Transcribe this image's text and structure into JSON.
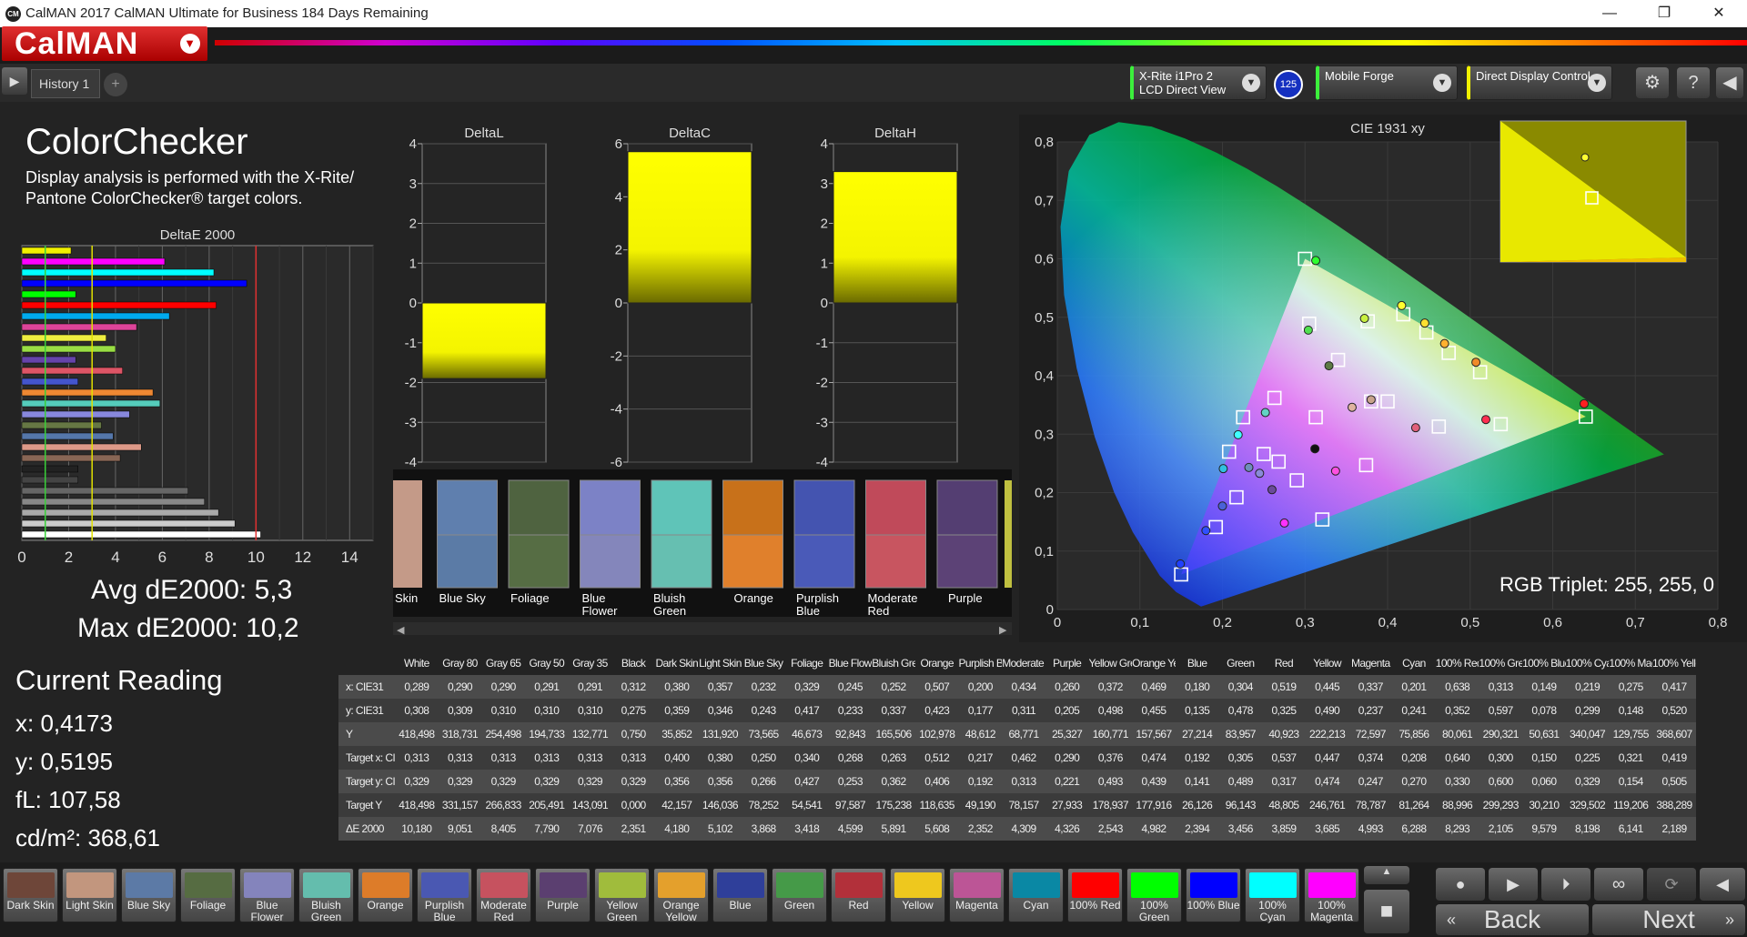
{
  "window": {
    "title": "CalMAN 2017 CalMAN Ultimate for Business 184 Days Remaining",
    "minimize": "—",
    "maximize": "❐",
    "close": "✕"
  },
  "logo": "CalMAN",
  "tabs": {
    "history": "History 1",
    "add": "+"
  },
  "devices": {
    "meter_line1": "X-Rite i1Pro 2",
    "meter_line2": "LCD Direct View",
    "meter_badge": "125",
    "source": "Mobile Forge",
    "display": "Direct Display Control"
  },
  "page": {
    "title": "ColorChecker",
    "desc_line1": "Display analysis is performed with the X-Rite/",
    "desc_line2": "Pantone ColorChecker® target colors."
  },
  "deltae_chart": {
    "title": "DeltaE 2000",
    "ticks": [
      "0",
      "2",
      "4",
      "6",
      "8",
      "10",
      "12",
      "14"
    ],
    "xlim": [
      0,
      15
    ],
    "bars": [
      {
        "v": 2.1,
        "c": "#f0f000"
      },
      {
        "v": 6.1,
        "c": "#ff00ff"
      },
      {
        "v": 8.2,
        "c": "#00ffff"
      },
      {
        "v": 9.6,
        "c": "#0000ff"
      },
      {
        "v": 2.3,
        "c": "#00ff00"
      },
      {
        "v": 8.3,
        "c": "#ff0000"
      },
      {
        "v": 6.3,
        "c": "#00aaee"
      },
      {
        "v": 4.9,
        "c": "#dd4499"
      },
      {
        "v": 3.6,
        "c": "#eeee40"
      },
      {
        "v": 4.0,
        "c": "#99dd44"
      },
      {
        "v": 2.3,
        "c": "#6644aa"
      },
      {
        "v": 4.3,
        "c": "#dd5566"
      },
      {
        "v": 2.4,
        "c": "#4455cc"
      },
      {
        "v": 5.6,
        "c": "#ee8833"
      },
      {
        "v": 5.9,
        "c": "#55ccbb"
      },
      {
        "v": 4.6,
        "c": "#8888dd"
      },
      {
        "v": 3.4,
        "c": "#667744"
      },
      {
        "v": 3.9,
        "c": "#5577aa"
      },
      {
        "v": 5.1,
        "c": "#dd9988"
      },
      {
        "v": 4.2,
        "c": "#886655"
      },
      {
        "v": 2.4,
        "c": "#222222"
      },
      {
        "v": 2.4,
        "c": "#444444"
      },
      {
        "v": 7.1,
        "c": "#666666"
      },
      {
        "v": 7.8,
        "c": "#888888"
      },
      {
        "v": 8.4,
        "c": "#aaaaaa"
      },
      {
        "v": 9.1,
        "c": "#cccccc"
      },
      {
        "v": 10.2,
        "c": "#ffffff"
      }
    ]
  },
  "delta_charts": [
    {
      "title": "DeltaL",
      "ticks": [
        "4",
        "3",
        "2",
        "1",
        "0",
        "-1",
        "-2",
        "-3",
        "-4"
      ],
      "ylim": [
        -4,
        4
      ],
      "value": -1.9
    },
    {
      "title": "DeltaC",
      "ticks": [
        "6",
        "4",
        "2",
        "0",
        "-2",
        "-4",
        "-6"
      ],
      "ylim": [
        -6,
        6
      ],
      "value": 5.7
    },
    {
      "title": "DeltaH",
      "ticks": [
        "4",
        "3",
        "2",
        "1",
        "0",
        "-1",
        "-2",
        "-3",
        "-4"
      ],
      "ylim": [
        -4,
        4
      ],
      "value": 3.3
    }
  ],
  "patches": [
    {
      "name": "Skin",
      "a": "#c49a88",
      "t": "#c79f8a"
    },
    {
      "name": "Blue Sky",
      "a": "#5f7fae",
      "t": "#5b7ba6"
    },
    {
      "name": "Foliage",
      "a": "#4f6340",
      "t": "#566d44"
    },
    {
      "name": "Blue Flower",
      "a": "#7c82c6",
      "t": "#8486bb"
    },
    {
      "name": "Bluish Green",
      "a": "#5fc4b8",
      "t": "#66bfb1"
    },
    {
      "name": "Orange",
      "a": "#c8711a",
      "t": "#e0802c"
    },
    {
      "name": "Purplish Blue",
      "a": "#4454b0",
      "t": "#4a5ab8"
    },
    {
      "name": "Moderate Red",
      "a": "#c04a5a",
      "t": "#c85560"
    },
    {
      "name": "Purple",
      "a": "#543e72",
      "t": "#5c4276"
    }
  ],
  "patch_labels": [
    "Skin",
    "Blue Sky",
    "Foliage",
    "Blue\nFlower",
    "Bluish\nGreen",
    "Orange",
    "Purplish\nBlue",
    "Moderate\nRed",
    "Purple"
  ],
  "summary": {
    "avg": "Avg dE2000: 5,3",
    "max": "Max dE2000: 10,2"
  },
  "current": {
    "title": "Current Reading",
    "x": "x: 0,4173",
    "y": "y: 0,5195",
    "fl": "fL: 107,58",
    "cdm": "cd/m²: 368,61"
  },
  "cie": {
    "title": "CIE 1931 xy",
    "xticks": [
      "0",
      "0,1",
      "0,2",
      "0,3",
      "0,4",
      "0,5",
      "0,6",
      "0,7",
      "0,8"
    ],
    "yticks": [
      "0,8",
      "0,7",
      "0,6",
      "0,5",
      "0,4",
      "0,3",
      "0,2",
      "0,1",
      "0"
    ],
    "triplet": "RGB Triplet: 255, 255, 0",
    "targets": [
      [
        0.313,
        0.329
      ],
      [
        0.4,
        0.356
      ],
      [
        0.38,
        0.356
      ],
      [
        0.25,
        0.266
      ],
      [
        0.34,
        0.427
      ],
      [
        0.268,
        0.253
      ],
      [
        0.263,
        0.362
      ],
      [
        0.512,
        0.406
      ],
      [
        0.217,
        0.192
      ],
      [
        0.462,
        0.313
      ],
      [
        0.29,
        0.221
      ],
      [
        0.376,
        0.493
      ],
      [
        0.474,
        0.439
      ],
      [
        0.192,
        0.141
      ],
      [
        0.305,
        0.489
      ],
      [
        0.537,
        0.317
      ],
      [
        0.447,
        0.474
      ],
      [
        0.374,
        0.247
      ],
      [
        0.208,
        0.27
      ],
      [
        0.64,
        0.33
      ],
      [
        0.3,
        0.6
      ],
      [
        0.15,
        0.06
      ],
      [
        0.225,
        0.329
      ],
      [
        0.321,
        0.154
      ],
      [
        0.419,
        0.505
      ]
    ],
    "measured": [
      {
        "x": 0.312,
        "y": 0.275,
        "c": "#111"
      },
      {
        "x": 0.38,
        "y": 0.359,
        "c": "#c9a38c"
      },
      {
        "x": 0.357,
        "y": 0.346,
        "c": "#dfb3a0"
      },
      {
        "x": 0.232,
        "y": 0.243,
        "c": "#6f8fbb"
      },
      {
        "x": 0.329,
        "y": 0.417,
        "c": "#5d7a44"
      },
      {
        "x": 0.245,
        "y": 0.233,
        "c": "#8a8ad8"
      },
      {
        "x": 0.252,
        "y": 0.337,
        "c": "#64d3c4"
      },
      {
        "x": 0.507,
        "y": 0.423,
        "c": "#f08a2a"
      },
      {
        "x": 0.2,
        "y": 0.177,
        "c": "#4a62d8"
      },
      {
        "x": 0.434,
        "y": 0.311,
        "c": "#e0607a"
      },
      {
        "x": 0.26,
        "y": 0.205,
        "c": "#6a4a9a"
      },
      {
        "x": 0.372,
        "y": 0.498,
        "c": "#c8f040"
      },
      {
        "x": 0.469,
        "y": 0.455,
        "c": "#ffb030"
      },
      {
        "x": 0.18,
        "y": 0.135,
        "c": "#3050ff"
      },
      {
        "x": 0.304,
        "y": 0.478,
        "c": "#50e050"
      },
      {
        "x": 0.519,
        "y": 0.325,
        "c": "#ff3050"
      },
      {
        "x": 0.445,
        "y": 0.49,
        "c": "#ffe030"
      },
      {
        "x": 0.337,
        "y": 0.237,
        "c": "#ff50e0"
      },
      {
        "x": 0.201,
        "y": 0.241,
        "c": "#30c0e0"
      },
      {
        "x": 0.638,
        "y": 0.352,
        "c": "#ff2020"
      },
      {
        "x": 0.313,
        "y": 0.597,
        "c": "#30ff30"
      },
      {
        "x": 0.149,
        "y": 0.078,
        "c": "#2040ff"
      },
      {
        "x": 0.219,
        "y": 0.299,
        "c": "#40ffff"
      },
      {
        "x": 0.275,
        "y": 0.148,
        "c": "#ff30ff"
      },
      {
        "x": 0.417,
        "y": 0.52,
        "c": "#ffff30"
      }
    ]
  },
  "table": {
    "headers": [
      "White",
      "Gray 80",
      "Gray 65",
      "Gray 50",
      "Gray 35",
      "Black",
      "Dark Skin",
      "Light Skin",
      "Blue Sky",
      "Foliage",
      "Blue Flower",
      "Bluish Green",
      "Orange",
      "Purplish Blue",
      "Moderate Red",
      "Purple",
      "Yellow Green",
      "Orange Yellow",
      "Blue",
      "Green",
      "Red",
      "Yellow",
      "Magenta",
      "Cyan",
      "100% Red",
      "100% Green",
      "100% Blue",
      "100% Cyan",
      "100% Magenta",
      "100% Yellow"
    ],
    "rows": [
      {
        "label": "x: CIE31",
        "vals": [
          "0,289",
          "0,290",
          "0,290",
          "0,291",
          "0,291",
          "0,312",
          "0,380",
          "0,357",
          "0,232",
          "0,329",
          "0,245",
          "0,252",
          "0,507",
          "0,200",
          "0,434",
          "0,260",
          "0,372",
          "0,469",
          "0,180",
          "0,304",
          "0,519",
          "0,445",
          "0,337",
          "0,201",
          "0,638",
          "0,313",
          "0,149",
          "0,219",
          "0,275",
          "0,417"
        ]
      },
      {
        "label": "y: CIE31",
        "vals": [
          "0,308",
          "0,309",
          "0,310",
          "0,310",
          "0,310",
          "0,275",
          "0,359",
          "0,346",
          "0,243",
          "0,417",
          "0,233",
          "0,337",
          "0,423",
          "0,177",
          "0,311",
          "0,205",
          "0,498",
          "0,455",
          "0,135",
          "0,478",
          "0,325",
          "0,490",
          "0,237",
          "0,241",
          "0,352",
          "0,597",
          "0,078",
          "0,299",
          "0,148",
          "0,520"
        ]
      },
      {
        "label": "Y",
        "vals": [
          "418,498",
          "318,731",
          "254,498",
          "194,733",
          "132,771",
          "0,750",
          "35,852",
          "131,920",
          "73,565",
          "46,673",
          "92,843",
          "165,506",
          "102,978",
          "48,612",
          "68,771",
          "25,327",
          "160,771",
          "157,567",
          "27,214",
          "83,957",
          "40,923",
          "222,213",
          "72,597",
          "75,856",
          "80,061",
          "290,321",
          "50,631",
          "340,047",
          "129,755",
          "368,607"
        ]
      },
      {
        "label": "Target x: CIE31",
        "vals": [
          "0,313",
          "0,313",
          "0,313",
          "0,313",
          "0,313",
          "0,313",
          "0,400",
          "0,380",
          "0,250",
          "0,340",
          "0,268",
          "0,263",
          "0,512",
          "0,217",
          "0,462",
          "0,290",
          "0,376",
          "0,474",
          "0,192",
          "0,305",
          "0,537",
          "0,447",
          "0,374",
          "0,208",
          "0,640",
          "0,300",
          "0,150",
          "0,225",
          "0,321",
          "0,419"
        ]
      },
      {
        "label": "Target y: CIE31",
        "vals": [
          "0,329",
          "0,329",
          "0,329",
          "0,329",
          "0,329",
          "0,329",
          "0,356",
          "0,356",
          "0,266",
          "0,427",
          "0,253",
          "0,362",
          "0,406",
          "0,192",
          "0,313",
          "0,221",
          "0,493",
          "0,439",
          "0,141",
          "0,489",
          "0,317",
          "0,474",
          "0,247",
          "0,270",
          "0,330",
          "0,600",
          "0,060",
          "0,329",
          "0,154",
          "0,505"
        ]
      },
      {
        "label": "Target Y",
        "vals": [
          "418,498",
          "331,157",
          "266,833",
          "205,491",
          "143,091",
          "0,000",
          "42,157",
          "146,036",
          "78,252",
          "54,541",
          "97,587",
          "175,238",
          "118,635",
          "49,190",
          "78,157",
          "27,933",
          "178,937",
          "177,916",
          "26,126",
          "96,143",
          "48,805",
          "246,761",
          "78,787",
          "81,264",
          "88,996",
          "299,293",
          "30,210",
          "329,502",
          "119,206",
          "388,289"
        ]
      },
      {
        "label": "ΔE 2000",
        "vals": [
          "10,180",
          "9,051",
          "8,405",
          "7,790",
          "7,076",
          "2,351",
          "4,180",
          "5,102",
          "3,868",
          "3,418",
          "4,599",
          "5,891",
          "5,608",
          "2,352",
          "4,309",
          "4,326",
          "2,543",
          "4,982",
          "2,394",
          "3,456",
          "3,859",
          "3,685",
          "4,993",
          "6,288",
          "8,293",
          "2,105",
          "9,579",
          "8,198",
          "6,141",
          "2,189"
        ]
      }
    ]
  },
  "swatches": [
    {
      "label": "Dark Skin",
      "color": "#6e4639"
    },
    {
      "label": "Light Skin",
      "color": "#c2967e"
    },
    {
      "label": "Blue Sky",
      "color": "#5c7aa6"
    },
    {
      "label": "Foliage",
      "color": "#566c42"
    },
    {
      "label": "Blue Flower",
      "color": "#8484bc"
    },
    {
      "label": "Bluish Green",
      "color": "#64bdad"
    },
    {
      "label": "Orange",
      "color": "#dd7c29"
    },
    {
      "label": "Purplish Blue",
      "color": "#4a58b2"
    },
    {
      "label": "Moderate Red",
      "color": "#c6525f"
    },
    {
      "label": "Purple",
      "color": "#5b3f70"
    },
    {
      "label": "Yellow Green",
      "color": "#a0bc3c"
    },
    {
      "label": "Orange Yellow",
      "color": "#e4a02c"
    },
    {
      "label": "Blue",
      "color": "#2f3f9a"
    },
    {
      "label": "Green",
      "color": "#459a48"
    },
    {
      "label": "Red",
      "color": "#b2303a"
    },
    {
      "label": "Yellow",
      "color": "#eec81e"
    },
    {
      "label": "Magenta",
      "color": "#bc5596"
    },
    {
      "label": "Cyan",
      "color": "#0a88a4"
    },
    {
      "label": "100% Red",
      "color": "#ff0000"
    },
    {
      "label": "100% Green",
      "color": "#00ff00"
    },
    {
      "label": "100% Blue",
      "color": "#0000ff"
    },
    {
      "label": "100% Cyan",
      "color": "#00ffff"
    },
    {
      "label": "100% Magenta",
      "color": "#ff00ff"
    }
  ],
  "controls": {
    "back": "Back",
    "next": "Next"
  }
}
